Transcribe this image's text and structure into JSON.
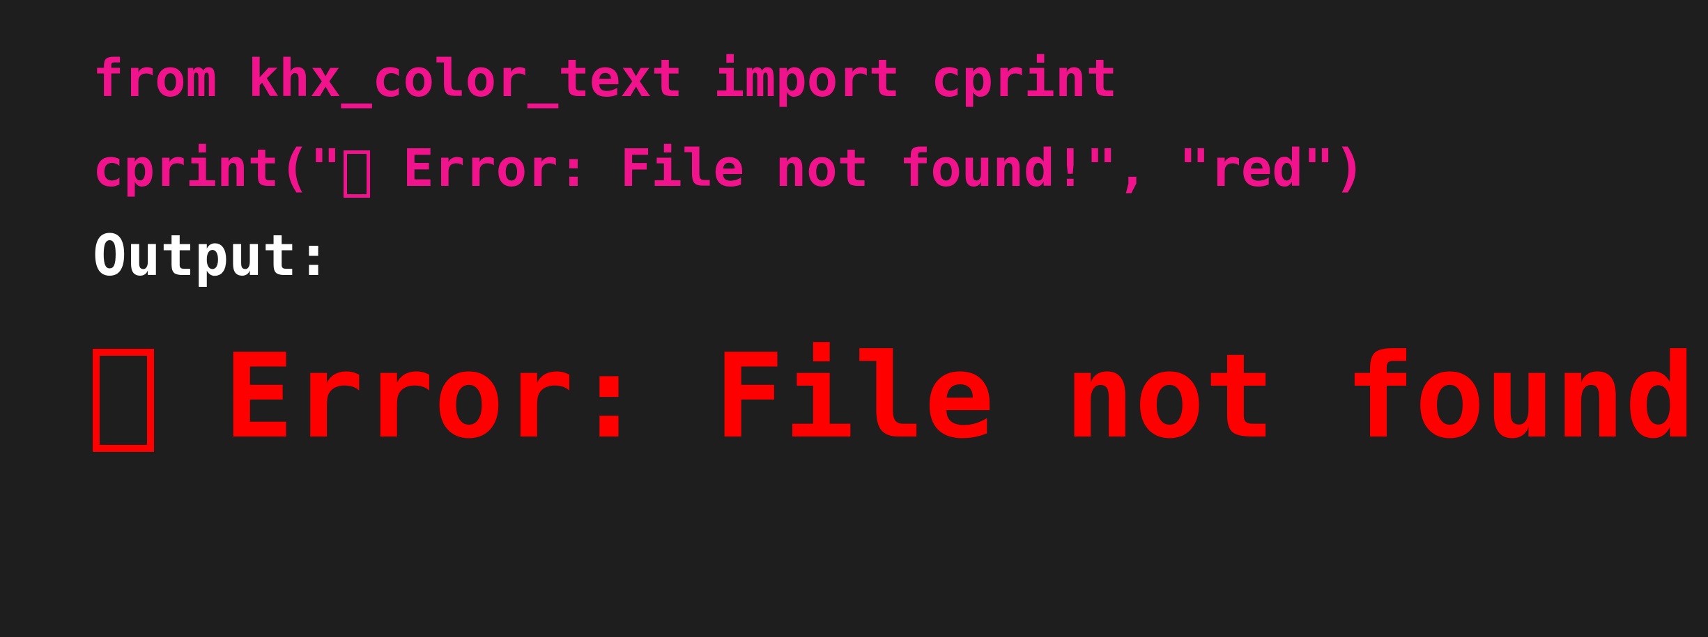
{
  "code_lines": {
    "line1": "from khx_color_text import cprint",
    "line2_prefix": "cprint(\"",
    "line2_suffix": " Error: File not found!\", \"red\")"
  },
  "output_label": "Output:",
  "output_text": "Error: File not found!",
  "icons": {
    "missing_glyph": "missing-glyph-box"
  },
  "colors": {
    "background": "#1e1e1e",
    "code": "#f0138c",
    "label": "#ffffff",
    "output": "#ff0000"
  }
}
